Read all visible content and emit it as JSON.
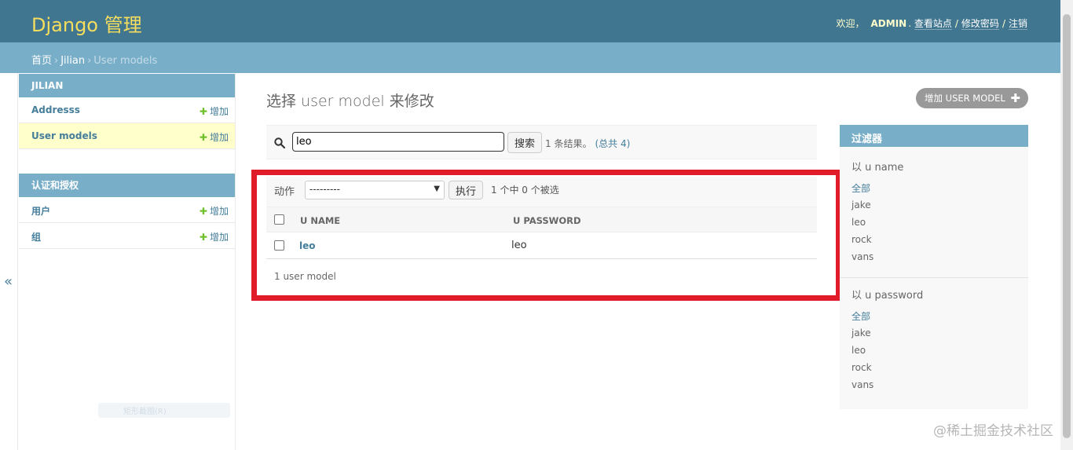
{
  "header": {
    "site_name": "Django 管理",
    "welcome": "欢迎，",
    "username": "ADMIN",
    "view_site": "查看站点",
    "change_password": "修改密码",
    "logout": "注销"
  },
  "breadcrumbs": {
    "home": "首页",
    "app": "Jilian",
    "current": "User models"
  },
  "sidebar": {
    "toggle": "«",
    "modules": [
      {
        "caption": "JILIAN",
        "items": [
          {
            "name": "Addresss",
            "add": "增加"
          },
          {
            "name": "User models",
            "add": "增加"
          }
        ]
      },
      {
        "caption": "认证和授权",
        "items": [
          {
            "name": "用户",
            "add": "增加"
          },
          {
            "name": "组",
            "add": "增加"
          }
        ]
      }
    ],
    "faint_tip": "矩形截图(R)"
  },
  "main": {
    "title": "选择 user model 来修改",
    "add_button": "增加 USER MODEL",
    "search": {
      "value": "leo",
      "button": "搜索",
      "result": "1 条结果。",
      "total": "(总共 4)"
    },
    "actions": {
      "label": "动作",
      "selected": "---------",
      "run": "执行",
      "counter": "1 个中 0 个被选"
    },
    "table": {
      "headers": [
        "U NAME",
        "U PASSWORD"
      ],
      "rows": [
        {
          "u_name": "leo",
          "u_password": "leo"
        }
      ]
    },
    "paginator": "1 user model"
  },
  "filter": {
    "caption": "过滤器",
    "groups": [
      {
        "title": "以 u name",
        "choices": [
          "全部",
          "jake",
          "leo",
          "rock",
          "vans"
        ]
      },
      {
        "title": "以 u password",
        "choices": [
          "全部",
          "jake",
          "leo",
          "rock",
          "vans"
        ]
      }
    ]
  },
  "watermark": "@稀土掘金技术社区",
  "colors": {
    "header": "#417690",
    "breadcrumbs": "#79aec8",
    "highlight": "#e01b2a",
    "link": "#447e9b",
    "add_plus": "#70bf2b"
  }
}
